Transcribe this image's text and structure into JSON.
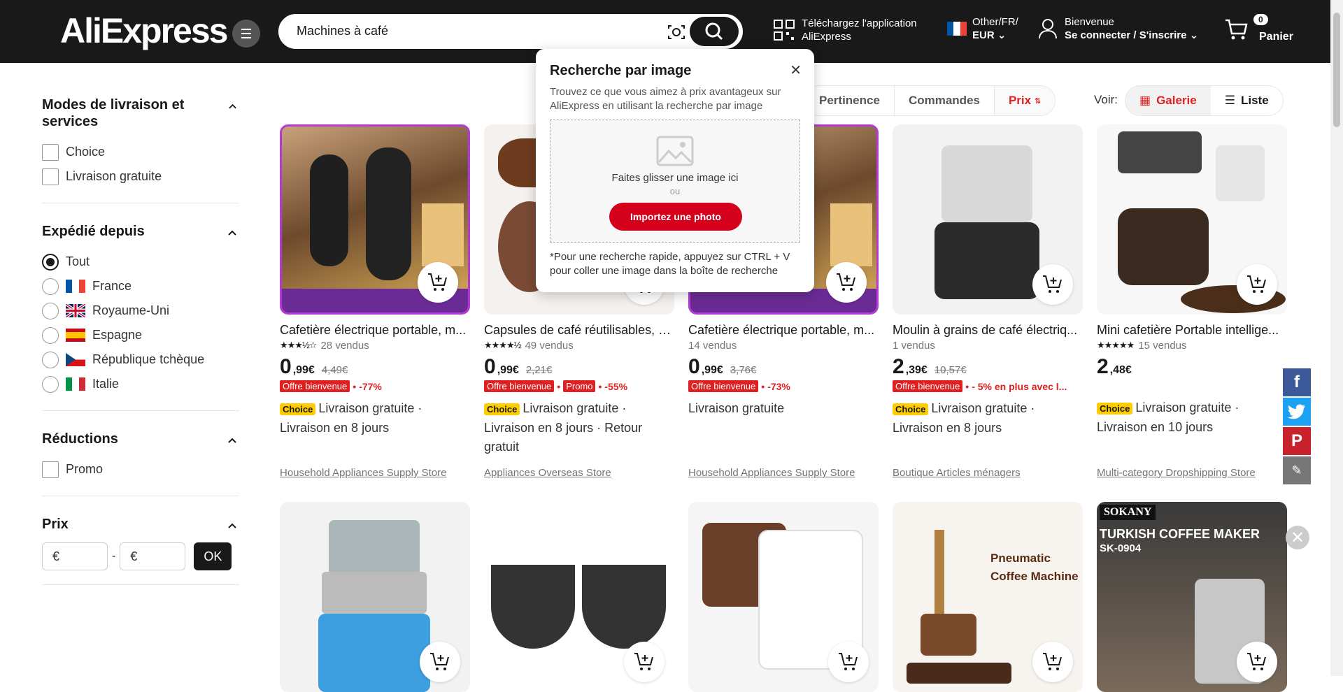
{
  "header": {
    "logo": "AliExpress",
    "search_value": "Machines à café",
    "app_line1": "Téléchargez l'application",
    "app_line2": "AliExpress",
    "locale_line1": "Other/FR/",
    "locale_line2": "EUR",
    "welcome": "Bienvenue",
    "signin": "Se connecter / S'inscrire",
    "cart_count": "0",
    "cart_label": "Panier"
  },
  "sidebar": {
    "delivery": {
      "title": "Modes de livraison et services",
      "options": [
        "Choice",
        "Livraison gratuite"
      ]
    },
    "shipped": {
      "title": "Expédié depuis",
      "options": [
        "Tout",
        "France",
        "Royaume-Uni",
        "Espagne",
        "République tchèque",
        "Italie"
      ]
    },
    "discounts": {
      "title": "Réductions",
      "options": [
        "Promo"
      ]
    },
    "price": {
      "title": "Prix",
      "min_placeholder": "€",
      "max_placeholder": "€",
      "separator": "-",
      "ok": "OK"
    }
  },
  "sort": {
    "items": [
      "Pertinence",
      "Commandes",
      "Prix"
    ],
    "view_label": "Voir:",
    "gallery": "Galerie",
    "list": "Liste"
  },
  "popup": {
    "title": "Recherche par image",
    "desc": "Trouvez ce que vous aimez à prix avantageux sur AliExpress en utilisant la recherche par image",
    "drop": "Faites glisser une image ici",
    "or": "ou",
    "upload": "Importez une photo",
    "hint": "*Pour une recherche rapide, appuyez sur CTRL + V pour coller une image dans la boîte de recherche"
  },
  "products": [
    {
      "title": "Cafetière électrique portable, m...",
      "sold": "28 vendus",
      "price_int": "0",
      "price_dec": ",99€",
      "old": "4,49€",
      "badge1": "Offre bienvenue",
      "badge2": "",
      "disc": "-77%",
      "ship": "Livraison gratuite · Livraison en 8 jours",
      "store": "Household Appliances Supply Store",
      "stars": "★★★½☆"
    },
    {
      "title": "Capsules de café réutilisables, 3...",
      "sold": "49 vendus",
      "price_int": "0",
      "price_dec": ",99€",
      "old": "2,21€",
      "badge1": "Offre bienvenue",
      "badge2": "Promo",
      "disc": "-55%",
      "ship": "Livraison gratuite · Livraison en 8 jours · Retour gratuit",
      "store": "Appliances Overseas Store",
      "stars": "★★★★½"
    },
    {
      "title": "Cafetière électrique portable, m...",
      "sold": "14 vendus",
      "price_int": "0",
      "price_dec": ",99€",
      "old": "3,76€",
      "badge1": "Offre bienvenue",
      "badge2": "",
      "disc": "-73%",
      "ship": "Livraison gratuite",
      "store": "Household Appliances Supply Store",
      "stars": ""
    },
    {
      "title": "Moulin à grains de café électriq...",
      "sold": "1 vendus",
      "price_int": "2",
      "price_dec": ",39€",
      "old": "10,57€",
      "badge1": "Offre bienvenue",
      "badge2": "",
      "disc": "- 5% en plus avec l...",
      "ship": "Livraison gratuite · Livraison en 8 jours",
      "store": "Boutique Articles ménagers",
      "stars": ""
    },
    {
      "title": "Mini cafetière Portable intellige...",
      "sold": "15 vendus",
      "price_int": "2",
      "price_dec": ",48€",
      "old": "",
      "badge1": "",
      "badge2": "",
      "disc": "",
      "ship": "Livraison gratuite · Livraison en 10 jours",
      "store": "Multi-category Dropshipping Store",
      "stars": "★★★★★"
    }
  ],
  "row2_labels": {
    "pneumatic": "Pneumatic Coffee Machine",
    "sokany": "SOKANY",
    "turkish": "TURKISH COFFEE MAKER",
    "model": "SK-0904"
  },
  "colors": {
    "accent": "#e02020",
    "brand_dark": "#191919",
    "choice": "#ffcc00",
    "upload_red": "#d4001c"
  }
}
